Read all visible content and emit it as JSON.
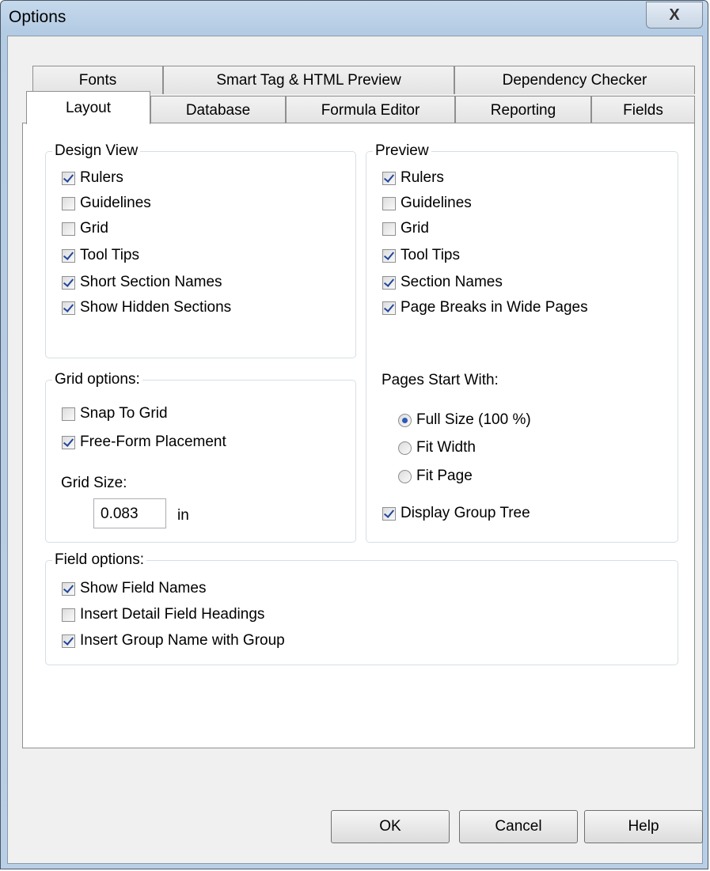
{
  "window": {
    "title": "Options",
    "close_glyph": "X"
  },
  "tabs": {
    "back_row": [
      "Fonts",
      "Smart Tag & HTML Preview",
      "Dependency Checker"
    ],
    "front_row": [
      "Layout",
      "Database",
      "Formula Editor",
      "Reporting",
      "Fields"
    ],
    "active": "Layout"
  },
  "design_view": {
    "label": "Design View",
    "items": [
      {
        "label": "Rulers",
        "checked": true
      },
      {
        "label": "Guidelines",
        "checked": false
      },
      {
        "label": "Grid",
        "checked": false
      },
      {
        "label": "Tool Tips",
        "checked": true
      },
      {
        "label": "Short Section Names",
        "checked": true
      },
      {
        "label": "Show Hidden Sections",
        "checked": true
      }
    ]
  },
  "preview": {
    "label": "Preview",
    "items": [
      {
        "label": "Rulers",
        "checked": true
      },
      {
        "label": "Guidelines",
        "checked": false
      },
      {
        "label": "Grid",
        "checked": false
      },
      {
        "label": "Tool Tips",
        "checked": true
      },
      {
        "label": "Section Names",
        "checked": true
      },
      {
        "label": "Page Breaks in Wide Pages",
        "checked": true
      }
    ]
  },
  "grid_options": {
    "label": "Grid options:",
    "items": [
      {
        "label": "Snap To Grid",
        "checked": false
      },
      {
        "label": "Free-Form Placement",
        "checked": true
      }
    ],
    "size_label": "Grid Size:",
    "size_value": "0.083",
    "size_unit": "in"
  },
  "pages_start": {
    "label": "Pages Start With:",
    "options": [
      {
        "label": "Full Size (100 %)",
        "selected": true
      },
      {
        "label": "Fit Width",
        "selected": false
      },
      {
        "label": "Fit Page",
        "selected": false
      }
    ],
    "group_tree": {
      "label": "Display Group Tree",
      "checked": true
    }
  },
  "field_options": {
    "label": "Field options:",
    "items": [
      {
        "label": "Show Field Names",
        "checked": true
      },
      {
        "label": "Insert Detail Field Headings",
        "checked": false
      },
      {
        "label": "Insert Group Name with Group",
        "checked": true
      }
    ]
  },
  "buttons": {
    "ok": "OK",
    "cancel": "Cancel",
    "help": "Help"
  }
}
